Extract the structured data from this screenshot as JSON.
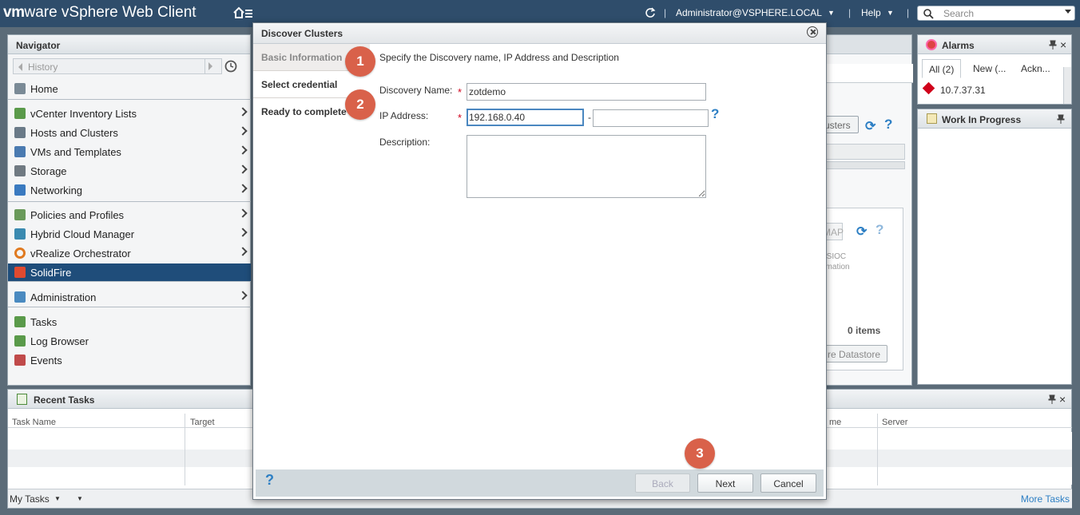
{
  "topbar": {
    "logo_brand": "vm",
    "logo_suffix": "ware",
    "product": " vSphere Web Client",
    "user": "Administrator@VSPHERE.LOCAL",
    "help": "Help",
    "search_placeholder": "Search"
  },
  "navigator": {
    "title": "Navigator",
    "history": "History",
    "items": [
      {
        "label": "Home",
        "icon": "home-icon",
        "chevron": false
      },
      {
        "label": "vCenter Inventory Lists",
        "icon": "inventory-icon",
        "chevron": true
      },
      {
        "label": "Hosts and Clusters",
        "icon": "hosts-icon",
        "chevron": true
      },
      {
        "label": "VMs and Templates",
        "icon": "vms-icon",
        "chevron": true
      },
      {
        "label": "Storage",
        "icon": "storage-icon",
        "chevron": true
      },
      {
        "label": "Networking",
        "icon": "network-icon",
        "chevron": true
      },
      {
        "label": "Policies and Profiles",
        "icon": "policies-icon",
        "chevron": true
      },
      {
        "label": "Hybrid Cloud Manager",
        "icon": "hybrid-cloud-icon",
        "chevron": true
      },
      {
        "label": "vRealize Orchestrator",
        "icon": "orchestrator-icon",
        "chevron": true
      },
      {
        "label": "SolidFire",
        "icon": "solidfire-icon",
        "chevron": false
      },
      {
        "label": "Administration",
        "icon": "admin-icon",
        "chevron": true
      },
      {
        "label": "Tasks",
        "icon": "tasks-icon",
        "chevron": false
      },
      {
        "label": "Log Browser",
        "icon": "log-icon",
        "chevron": false
      },
      {
        "label": "Events",
        "icon": "events-icon",
        "chevron": false
      }
    ]
  },
  "background": {
    "clusters_btn": "usters",
    "map_btn": "MAP",
    "sioc": "SSIOC",
    "sioc_sub": "omation",
    "items_count": "0 items",
    "datastore_btn": "re Datastore"
  },
  "alarms": {
    "title": "Alarms",
    "tabs": [
      "All (2)",
      "New (...",
      "Ackn..."
    ],
    "row": "10.7.37.31"
  },
  "wip": {
    "title": "Work In Progress"
  },
  "recent_tasks": {
    "title": "Recent Tasks",
    "columns": [
      "Task Name",
      "Target",
      "me",
      "Server"
    ],
    "my_tasks": "My Tasks",
    "more_tasks": "More Tasks"
  },
  "dialog": {
    "title": "Discover Clusters",
    "steps": [
      "Basic Information",
      "Select credential",
      "Ready to complete"
    ],
    "intro": "Specify the Discovery name, IP Address and Description",
    "discovery_label": "Discovery Name:",
    "discovery_value": "zotdemo",
    "ip_label": "IP Address:",
    "ip_value": "192.168.0.40",
    "ip_end_value": "",
    "ip_separator": "-",
    "description_label": "Description:",
    "required_mark": "*",
    "help_mark": "?",
    "buttons": {
      "back": "Back",
      "next": "Next",
      "cancel": "Cancel"
    }
  },
  "badges": [
    "1",
    "2",
    "3"
  ],
  "colors": {
    "badge": "#d9614a",
    "header": "#2f4d6b",
    "active_nav": "#1f4d7a",
    "help": "#2d7fc4",
    "required": "#d0021b"
  }
}
